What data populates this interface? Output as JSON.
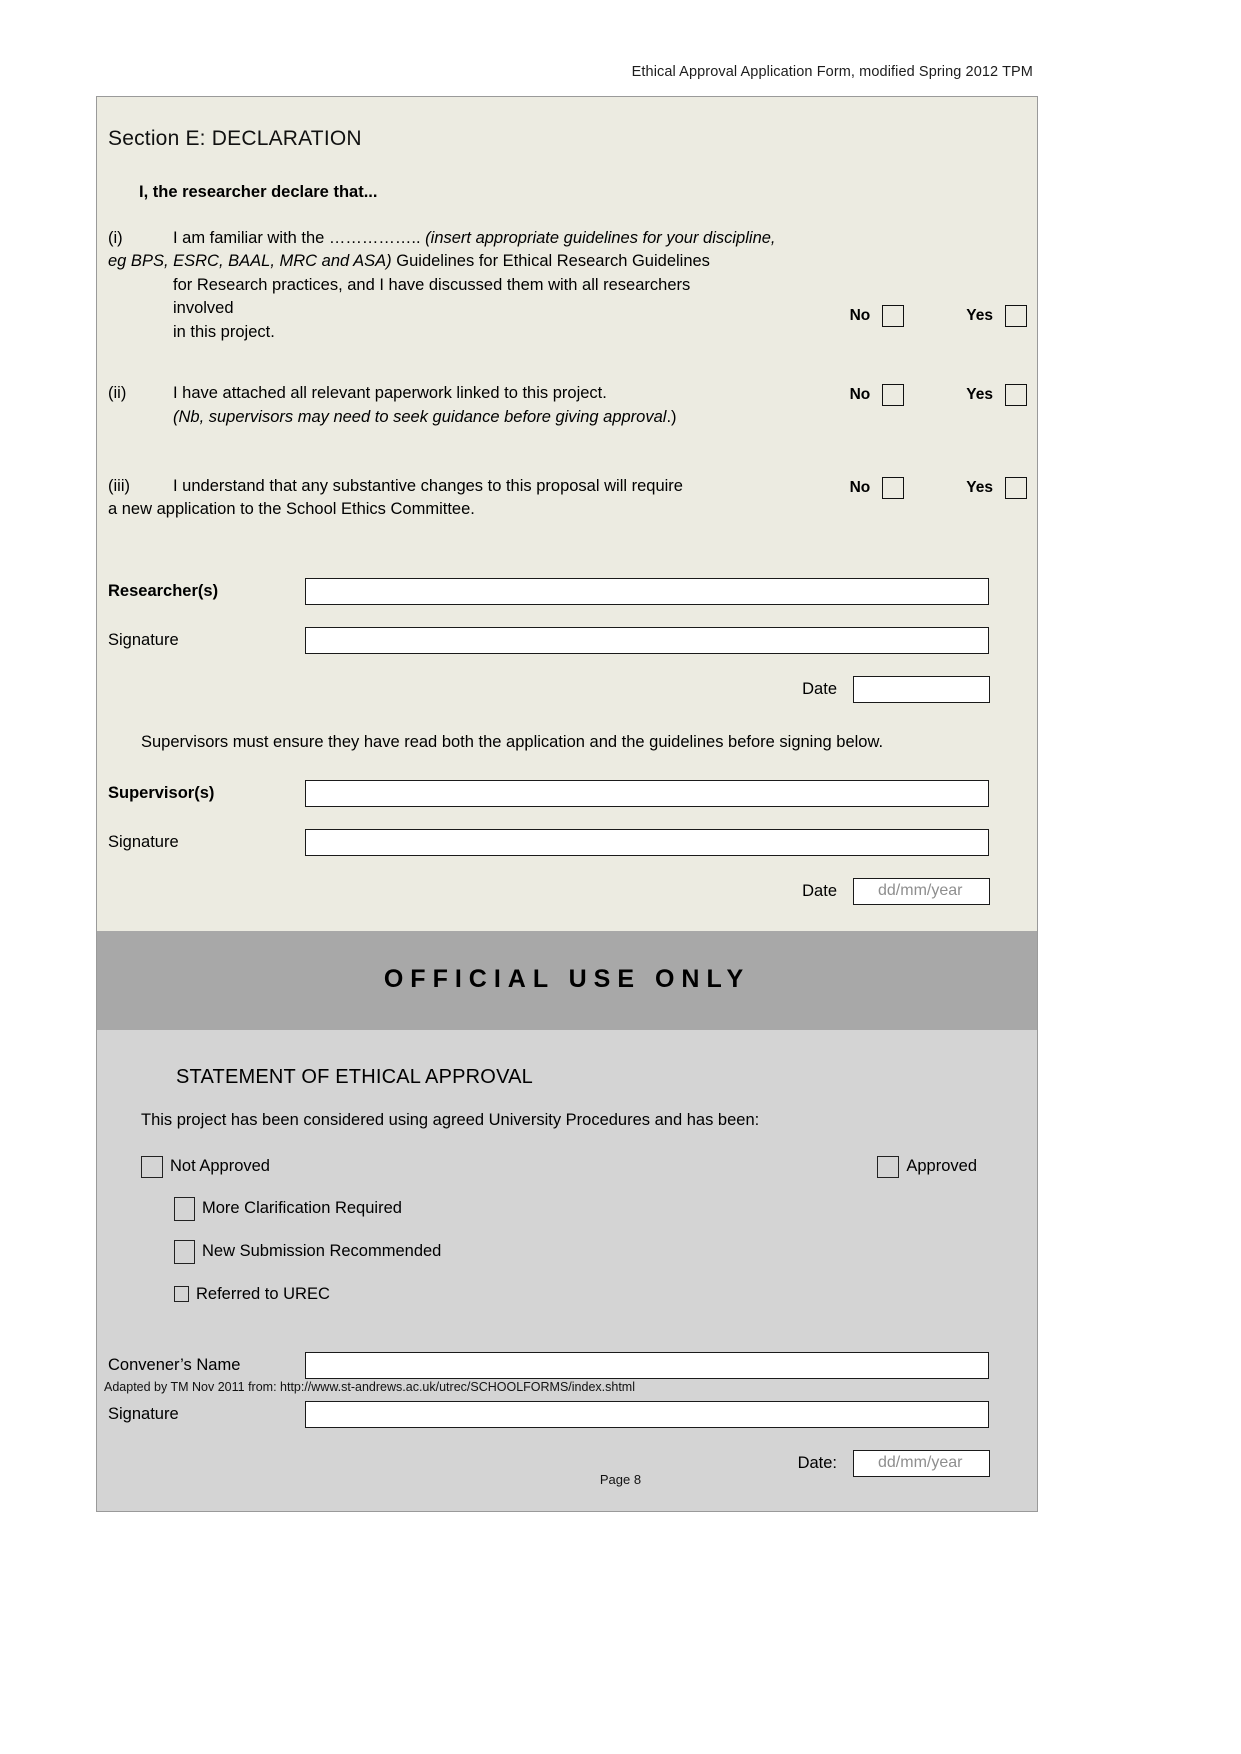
{
  "header": {
    "running_head": "Ethical Approval Application Form, modified Spring 2012  TPM"
  },
  "declaration": {
    "section_title": "Section E: DECLARATION",
    "lead_in": "I, the researcher declare that...",
    "items": [
      {
        "marker": "(i)",
        "line1_a": "I am familiar with the ……………..",
        "line1_b": "(insert appropriate guidelines for your discipline,",
        "line2_a": "eg BPS, ESRC, BAAL, MRC and ASA)",
        "line2_b": "Guidelines for Ethical Research Guidelines",
        "line3": "for Research practices, and I have discussed them with all researchers",
        "line4": "involved",
        "line5": "in this project.",
        "no_label": "No",
        "yes_label": "Yes"
      },
      {
        "marker": "(ii)",
        "line1": "I have attached all relevant paperwork linked to this project.",
        "line2_italic": "(Nb, supervisors may need to seek guidance before giving approval",
        "line2_tail": ".)",
        "no_label": "No",
        "yes_label": "Yes"
      },
      {
        "marker": "(iii)",
        "line1": "I understand that any substantive changes to this proposal will require",
        "line2": "a new application to the School Ethics Committee.",
        "no_label": "No",
        "yes_label": "Yes"
      }
    ],
    "researcher_label": "Researcher(s)",
    "researcher_value": "",
    "researcher_signature_label": "Signature",
    "researcher_signature_value": "",
    "researcher_date_label": "Date",
    "researcher_date_value": "",
    "supervisor_note": "Supervisors must ensure they have read both the application and the guidelines before signing below.",
    "supervisor_label": "Supervisor(s)",
    "supervisor_value": "",
    "supervisor_signature_label": "Signature",
    "supervisor_signature_value": "",
    "supervisor_date_label": "Date",
    "supervisor_date_placeholder": "dd/mm/year"
  },
  "official": {
    "banner": "OFFICIAL USE ONLY",
    "statement_title": "STATEMENT OF ETHICAL APPROVAL",
    "statement_sub": "This project has been considered using agreed University Procedures and has been:",
    "options": [
      {
        "label": "Not Approved"
      },
      {
        "label": "More Clarification Required"
      },
      {
        "label": "New Submission Recommended"
      },
      {
        "label": "Referred to UREC"
      }
    ],
    "approved_label": "Approved",
    "convener_label": "Convener’s Name",
    "convener_value": "",
    "convener_signature_label": "Signature",
    "convener_signature_value": "",
    "convener_date_label": "Date:",
    "convener_date_placeholder": "dd/mm/year"
  },
  "footer": {
    "adapted_note": "Adapted by TM Nov 2011 from: http://www.st-andrews.ac.uk/utrec/SCHOOLFORMS/index.shtml",
    "page_number": "Page 8"
  },
  "colors": {
    "declaration_bg": "#ECEBE1",
    "banner_bg": "#A8A8A8",
    "official_bg": "#D4D4D4",
    "field_border": "#1A1A1A",
    "placeholder": "#8E8E8E"
  }
}
